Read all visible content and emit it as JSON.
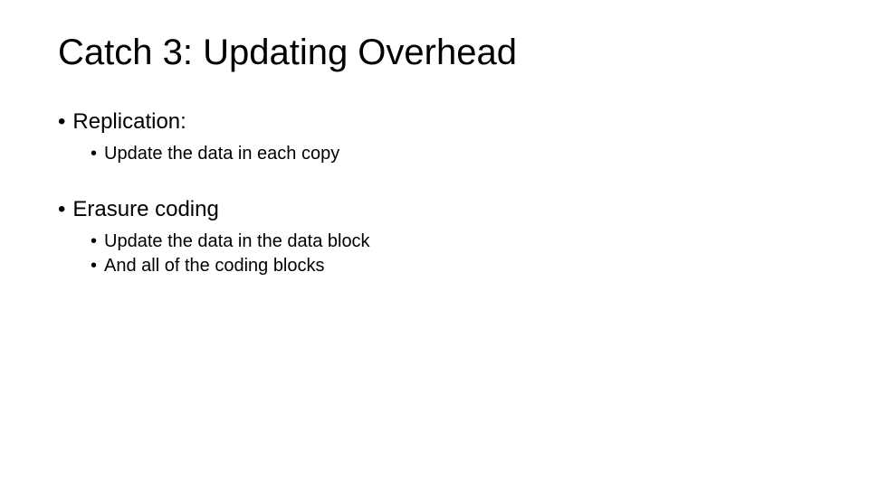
{
  "slide": {
    "title": "Catch 3: Updating Overhead",
    "bullets": [
      {
        "text": "Replication:",
        "subs": [
          "Update the data in each copy"
        ]
      },
      {
        "text": "Erasure coding",
        "subs": [
          "Update the data in the data block",
          "And all of the coding blocks"
        ]
      }
    ]
  }
}
